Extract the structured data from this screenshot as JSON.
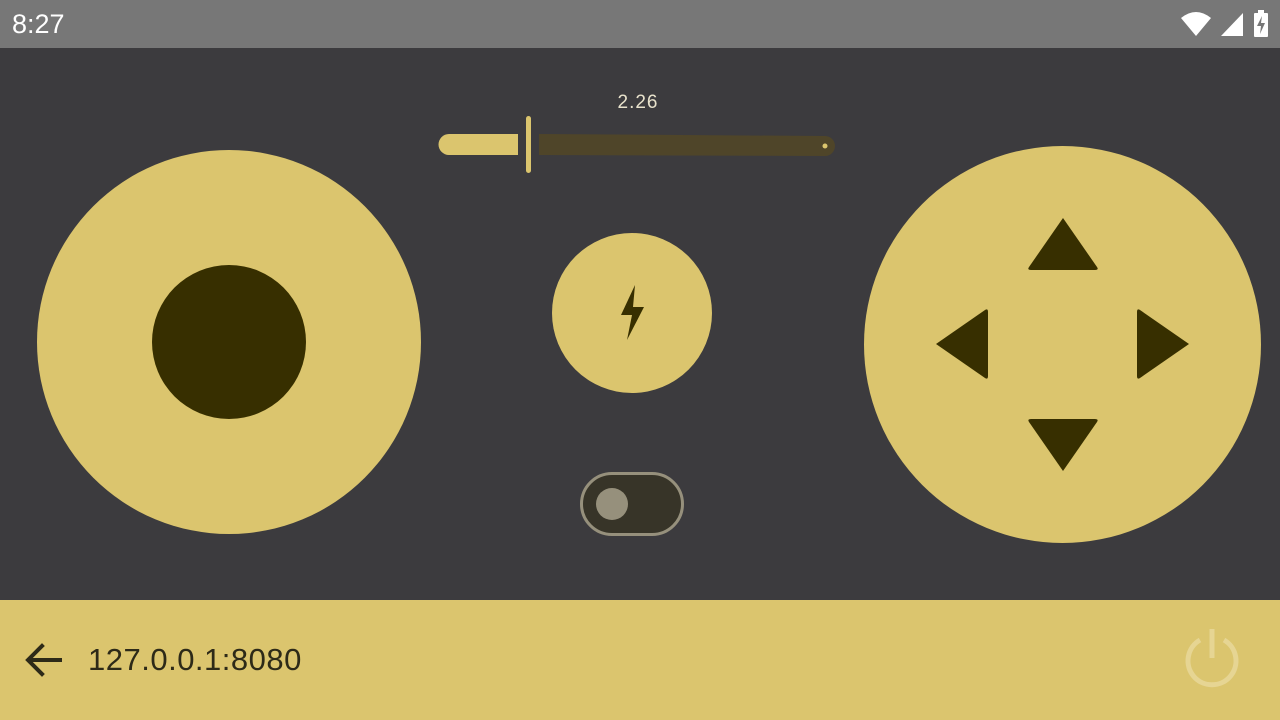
{
  "status_bar": {
    "time": "8:27",
    "icons": [
      "wifi-icon",
      "cellular-signal-icon",
      "battery-charging-icon"
    ]
  },
  "speed_slider": {
    "value_label": "2.26"
  },
  "controls": {
    "joystick": "joystick",
    "boost_icon": "lightning-bolt-icon",
    "toggle_state": "off",
    "dpad_icons": [
      "arrow-up-icon",
      "arrow-left-icon",
      "arrow-right-icon",
      "arrow-down-icon"
    ]
  },
  "bottom_bar": {
    "back_icon": "arrow-back-icon",
    "address": "127.0.0.1:8080",
    "power_icon": "power-icon"
  },
  "colors": {
    "background": "#3c3b3e",
    "accent": "#dbc56e",
    "dark_accent": "#372f00",
    "status_bar": "#777777"
  }
}
